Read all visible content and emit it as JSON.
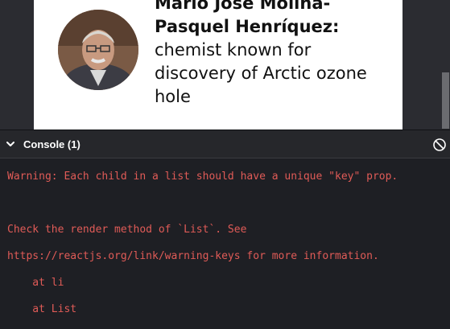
{
  "profile": {
    "name_line1": "Mario José Molina-",
    "name_line2": "Pasquel Henríquez:",
    "desc_lines": [
      "chemist known for",
      "discovery of Arctic ozone",
      "hole"
    ]
  },
  "console": {
    "title": "Console (1)",
    "lines": [
      "Warning: Each child in a list should have a unique \"key\" prop.",
      "Check the render method of `List`. See",
      "https://reactjs.org/link/warning-keys for more information.",
      "    at li",
      "    at List"
    ]
  },
  "colors": {
    "warning_text": "#e05b57",
    "console_bg": "#1e1f24"
  }
}
